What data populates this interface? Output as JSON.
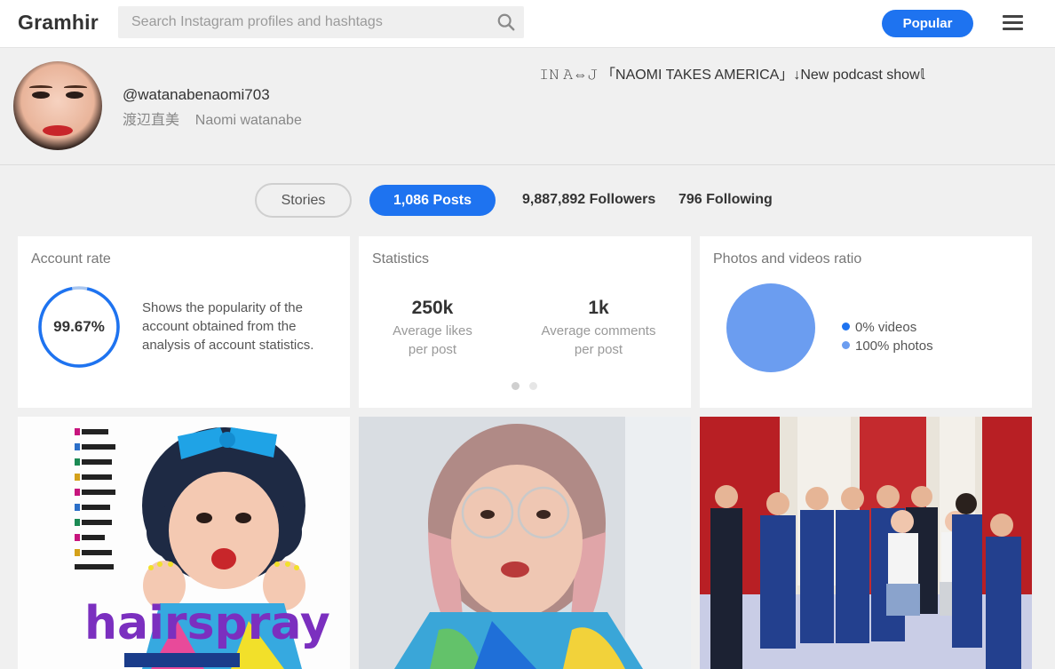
{
  "header": {
    "logo": "Gramhir",
    "search_placeholder": "Search Instagram profiles and hashtags",
    "search_icon": "search-icon",
    "popular_label": "Popular",
    "menu_icon": "hamburger-menu-icon"
  },
  "profile": {
    "bio": "𝙸𝙽 𝙰⇔𝙹 「NAOMI TAKES AMERICA」↓New podcast show𝕝",
    "username": "@watanabenaomi703",
    "full_name": "渡辺直美    Naomi watanabe"
  },
  "stats_bar": {
    "stories_label": "Stories",
    "posts_label": "1,086 Posts",
    "followers_label": "9,887,892 Followers",
    "following_label": "796 Following"
  },
  "account_rate": {
    "title": "Account rate",
    "value": "99.67%",
    "value_fraction": 0.9967,
    "description": "Shows the popularity of the account obtained from the analysis of account statistics."
  },
  "statistics": {
    "title": "Statistics",
    "items": [
      {
        "value": "250k",
        "label_line1": "Average likes",
        "label_line2": "per post"
      },
      {
        "value": "1k",
        "label_line1": "Average comments",
        "label_line2": "per post"
      }
    ],
    "carousel_page": 1,
    "carousel_pages": 2
  },
  "ratio": {
    "title": "Photos and videos ratio",
    "videos_label": "0% videos",
    "photos_label": "100% photos",
    "videos_fraction": 0.0,
    "photos_fraction": 1.0,
    "videos_color": "#1e73f0",
    "photos_color": "#6b9df0"
  },
  "posts": [
    {
      "image": "hairspray-musical-poster",
      "overlay_text": "hairspray"
    },
    {
      "image": "selfie-pink-hair-glasses"
    },
    {
      "image": "group-photo-blue-uniforms"
    }
  ],
  "colors": {
    "accent": "#1e73f0",
    "ring": "#1e73f0",
    "ring_track": "#a9c6ef"
  }
}
